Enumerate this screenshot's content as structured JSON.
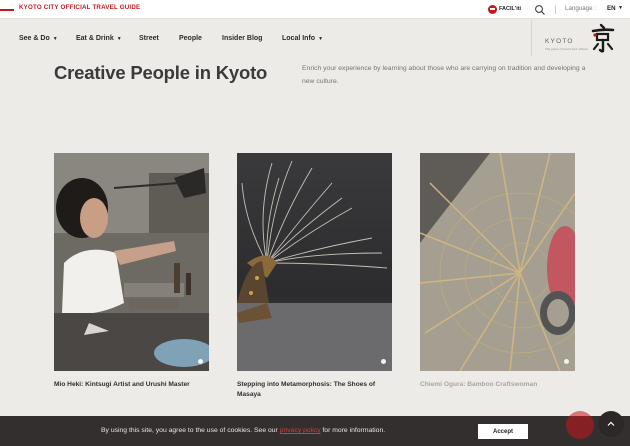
{
  "topbar": {
    "site_label": "KYOTO CITY OFFICIAL TRAVEL GUIDE",
    "facil_label": "FACIL'iti",
    "language_label": "Language :",
    "language_value": "EN"
  },
  "nav": {
    "items": [
      {
        "label": "See & Do",
        "has_dropdown": true
      },
      {
        "label": "Eat & Drink",
        "has_dropdown": true
      },
      {
        "label": "Street",
        "has_dropdown": false
      },
      {
        "label": "People",
        "has_dropdown": false
      },
      {
        "label": "Insider Blog",
        "has_dropdown": false
      },
      {
        "label": "Local Info",
        "has_dropdown": true
      }
    ],
    "logo_text": "KYOTO",
    "logo_tagline": "The place of heart and culture"
  },
  "page": {
    "title": "Creative People in Kyoto",
    "intro": "Enrich your experience by learning about those who are carrying on tradition and developing a new culture."
  },
  "cards": [
    {
      "caption": "Mio Heki: Kintsugi Artist and Urushi Master"
    },
    {
      "caption": "Stepping into Metamorphosis: The Shoes of Masaya"
    },
    {
      "caption": "Chiemi Ogura: Bamboo Craftswoman"
    }
  ],
  "cookie": {
    "text_before": "By using this site, you agree to the use of cookies. See our",
    "link_text": "privacy policy",
    "text_after": "for more information.",
    "accept_label": "Accept"
  },
  "colors": {
    "brand_red": "#c8161d",
    "background": "#ecebe7",
    "cookie_bg": "#332f2e"
  },
  "icons": [
    "search-icon",
    "facil-icon",
    "chat-icon",
    "arrow-up-icon",
    "kyoto-logo-icon"
  ]
}
